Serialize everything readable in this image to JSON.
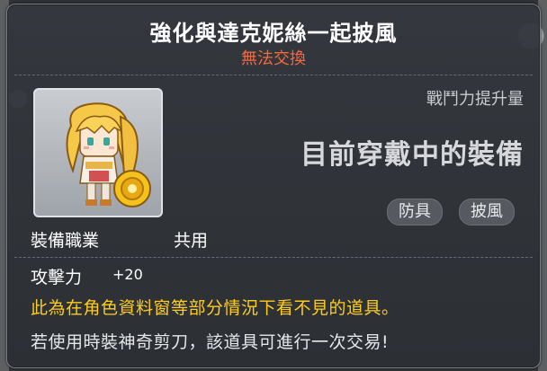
{
  "tooltip": {
    "title": "強化與達克妮絲一起披風",
    "trade_status": "無法交換",
    "stat_label": "戰鬥力提升量",
    "equipped_text": "目前穿戴中的裝備",
    "tags": [
      "防具",
      "披風"
    ],
    "job_label": "裝備職業",
    "job_value": "共用",
    "stats": [
      {
        "label": "攻擊力",
        "value": "+20"
      }
    ],
    "notes": [
      "此為在角色資料窗等部分情況下看不見的道具。",
      "若使用時裝神奇剪刀，該道具可進行一次交易!"
    ]
  },
  "colors": {
    "title": "#ffffff",
    "trade_status": "#f7683c",
    "note_highlight": "#ffcc1a"
  },
  "icons": {
    "item": "darkness-cape-icon"
  }
}
